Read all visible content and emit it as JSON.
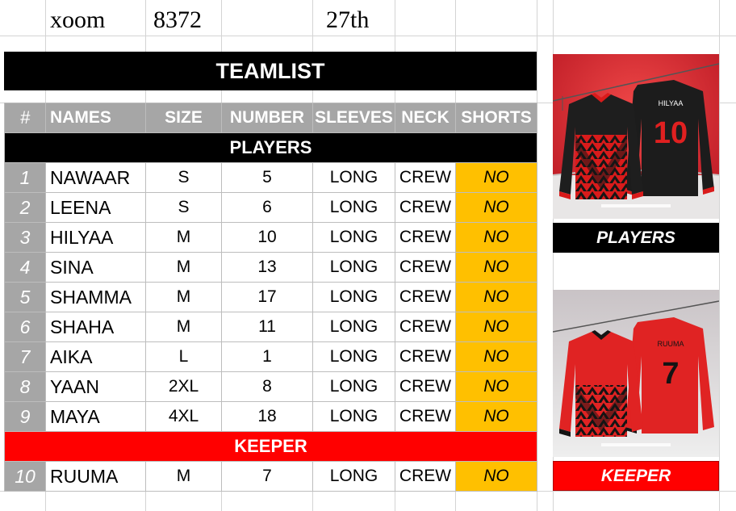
{
  "header": {
    "c1": "xoom",
    "c2": "8372",
    "c3": "27th"
  },
  "title": "TEAMLIST",
  "columns": [
    "#",
    "NAMES",
    "SIZE",
    "NUMBER",
    "SLEEVES",
    "NECK",
    "SHORTS"
  ],
  "sections": {
    "players": "PLAYERS",
    "keeper": "KEEPER"
  },
  "players": [
    {
      "n": "1",
      "name": "NAWAAR",
      "size": "S",
      "number": "5",
      "sleeves": "LONG",
      "neck": "CREW",
      "shorts": "NO"
    },
    {
      "n": "2",
      "name": "LEENA",
      "size": "S",
      "number": "6",
      "sleeves": "LONG",
      "neck": "CREW",
      "shorts": "NO"
    },
    {
      "n": "3",
      "name": "HILYAA",
      "size": "M",
      "number": "10",
      "sleeves": "LONG",
      "neck": "CREW",
      "shorts": "NO"
    },
    {
      "n": "4",
      "name": "SINA",
      "size": "M",
      "number": "13",
      "sleeves": "LONG",
      "neck": "CREW",
      "shorts": "NO"
    },
    {
      "n": "5",
      "name": "SHAMMA",
      "size": "M",
      "number": "17",
      "sleeves": "LONG",
      "neck": "CREW",
      "shorts": "NO"
    },
    {
      "n": "6",
      "name": "SHAHA",
      "size": "M",
      "number": "11",
      "sleeves": "LONG",
      "neck": "CREW",
      "shorts": "NO"
    },
    {
      "n": "7",
      "name": "AIKA",
      "size": "L",
      "number": "1",
      "sleeves": "LONG",
      "neck": "CREW",
      "shorts": "NO"
    },
    {
      "n": "8",
      "name": "YAAN",
      "size": "2XL",
      "number": "8",
      "sleeves": "LONG",
      "neck": "CREW",
      "shorts": "NO"
    },
    {
      "n": "9",
      "name": "MAYA",
      "size": "4XL",
      "number": "18",
      "sleeves": "LONG",
      "neck": "CREW",
      "shorts": "NO"
    }
  ],
  "keepers": [
    {
      "n": "10",
      "name": "RUUMA",
      "size": "M",
      "number": "7",
      "sleeves": "LONG",
      "neck": "CREW",
      "shorts": "NO"
    }
  ],
  "images": {
    "players": {
      "back_name": "HILYAA",
      "back_number": "10"
    },
    "keeper": {
      "back_name": "RUUMA",
      "back_number": "7"
    }
  },
  "labels": {
    "players": "PLAYERS",
    "keeper": "KEEPER"
  },
  "colors": {
    "black": "#000000",
    "red": "#ff0000",
    "gray": "#a6a6a6",
    "amber": "#ffc000"
  }
}
